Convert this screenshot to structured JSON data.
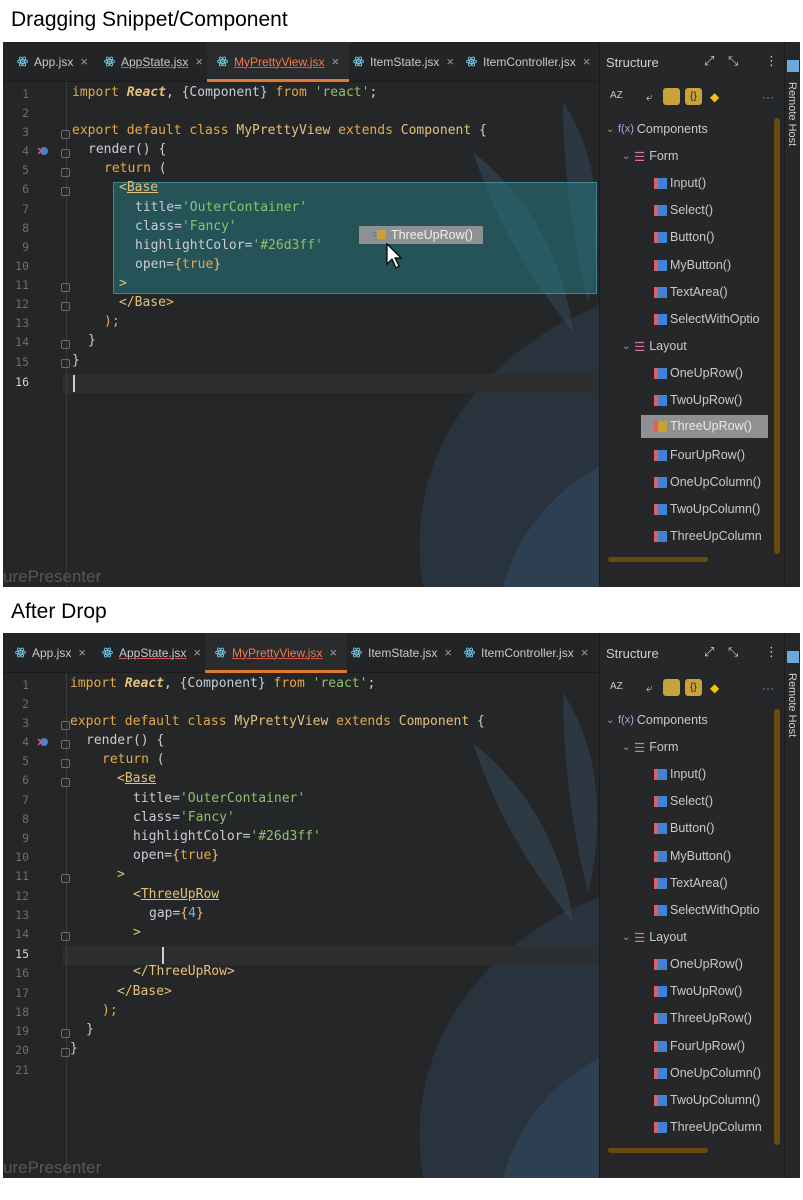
{
  "captions": {
    "top": "Dragging Snippet/Component",
    "bottom": "After Drop"
  },
  "tabs": [
    {
      "label": "App.jsx",
      "close": "×"
    },
    {
      "label": "AppState.jsx",
      "close": "×"
    },
    {
      "label": "MyPrettyView.jsx",
      "close": "×"
    },
    {
      "label": "ItemState.jsx",
      "close": "×"
    },
    {
      "label": "ItemController.jsx",
      "close": "×"
    }
  ],
  "structure": {
    "title": "Structure",
    "remote_host": "Remote Host",
    "components_label": "Components",
    "form_label": "Form",
    "form_items": [
      "Input()",
      "Select()",
      "Button()",
      "MyButton()",
      "TextArea()",
      "SelectWithOptio"
    ],
    "layout_label": "Layout",
    "layout_items": [
      "OneUpRow()",
      "TwoUpRow()",
      "ThreeUpRow()",
      "FourUpRow()",
      "OneUpColumn()",
      "TwoUpColumn()",
      "ThreeUpColumn"
    ],
    "selected_item": "ThreeUpRow()"
  },
  "drag_ghost": {
    "label": "ThreeUpRow()"
  },
  "background_text": "urePresenter",
  "code_before": {
    "line_numbers": [
      "1",
      "2",
      "3",
      "4",
      "5",
      "6",
      "7",
      "8",
      "9",
      "10",
      "11",
      "12",
      "13",
      "14",
      "15",
      "16"
    ],
    "current_line": "16",
    "line1": {
      "kw1": "import",
      "cls": "React",
      "mid": ", {Component} ",
      "kw2": "from",
      "str": "'react'",
      "end": ";"
    },
    "line3": {
      "kw1": "export default class",
      "name": "MyPrettyView",
      "kw2": "extends",
      "parent": "Component",
      "end": " {"
    },
    "line4": "render() {",
    "line5": {
      "kw": "return",
      "rest": " ("
    },
    "line6": {
      "lt": "<",
      "tag": "Base"
    },
    "line7": {
      "attr": "title=",
      "val": "'OuterContainer'"
    },
    "line8": {
      "attr": "class=",
      "val": "'Fancy'"
    },
    "line9": {
      "attr": "highlightColor=",
      "val": "'#26d3ff'"
    },
    "line10": {
      "attr": "open=",
      "lb": "{",
      "val": "true",
      "rb": "}"
    },
    "line11": ">",
    "line12": {
      "open": "</",
      "tag": "Base",
      "close": ">"
    },
    "line13": ");",
    "line14": "}",
    "line15": "}"
  },
  "code_after": {
    "line_numbers": [
      "1",
      "2",
      "3",
      "4",
      "5",
      "6",
      "7",
      "8",
      "9",
      "10",
      "11",
      "12",
      "13",
      "14",
      "15",
      "16",
      "17",
      "18",
      "19",
      "20",
      "21"
    ],
    "current_line": "15",
    "line12": {
      "lt": "<",
      "tag": "ThreeUpRow"
    },
    "line13": {
      "attr": "gap=",
      "lb": "{",
      "val": "4",
      "rb": "}"
    },
    "line14": ">",
    "line16": {
      "open": "</",
      "tag": "ThreeUpRow",
      "close": ">"
    },
    "line17": {
      "open": "</",
      "tag": "Base",
      "close": ">"
    },
    "line18": ");",
    "line19": "}",
    "line20": "}"
  },
  "colors": {
    "accent_tab": "#e2792e",
    "keyword": "#e6a94a",
    "string": "#8fc16b",
    "number": "#6fb3e0",
    "selection": "#26787f"
  }
}
